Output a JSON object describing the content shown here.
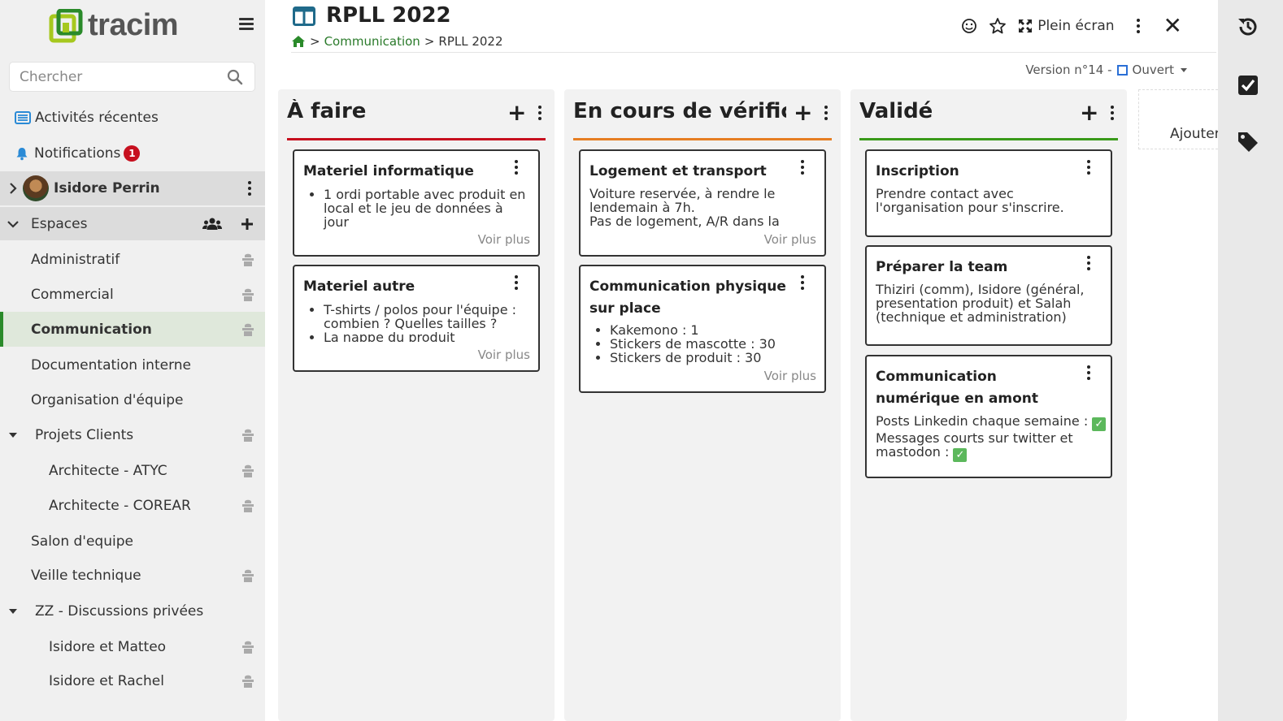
{
  "app": {
    "logo_text": "tracim"
  },
  "sidebar": {
    "search_placeholder": "Chercher",
    "recent_activities": "Activités récentes",
    "notifications": "Notifications",
    "notifications_count": "1",
    "user_name": "Isidore Perrin",
    "spaces_label": "Espaces",
    "spaces": [
      {
        "label": "Administratif"
      },
      {
        "label": "Commercial"
      },
      {
        "label": "Communication"
      },
      {
        "label": "Documentation interne"
      },
      {
        "label": "Organisation d'équipe"
      },
      {
        "label": "Projets Clients"
      },
      {
        "label": "Architecte - ATYC"
      },
      {
        "label": "Architecte - COREAR"
      },
      {
        "label": "Salon d'equipe"
      },
      {
        "label": "Veille technique"
      },
      {
        "label": "ZZ - Discussions privées"
      },
      {
        "label": "Isidore et Matteo"
      },
      {
        "label": "Isidore et Rachel"
      }
    ]
  },
  "header": {
    "title": "RPLL 2022",
    "breadcrumb_sep": ">",
    "breadcrumb_space": "Communication",
    "breadcrumb_current": "RPLL 2022",
    "fullscreen_label": "Plein écran",
    "version_label": "Version n°14 -",
    "status_label": "Ouvert"
  },
  "board": {
    "columns": [
      {
        "title": "À faire",
        "color": "#c7101f",
        "cards": [
          {
            "title": "Materiel informatique",
            "items": [
              "1 ordi portable avec produit en local et le jeu de données à jour"
            ],
            "more": "Voir plus"
          },
          {
            "title": "Materiel autre",
            "items": [
              "T-shirts / polos pour l'équipe : combien ? Quelles tailles ?",
              "La nappe du produit"
            ],
            "more": "Voir plus"
          }
        ]
      },
      {
        "title": "En cours de vérificati...",
        "color": "#e67e22",
        "cards": [
          {
            "title": "Logement et transport",
            "text": [
              "Voiture reservée, à rendre le lendemain à 7h.",
              "Pas de logement, A/R dans la"
            ],
            "more": "Voir plus"
          },
          {
            "title": "Communication physique sur place",
            "items": [
              "Kakemono : 1",
              "Stickers de mascotte : 30",
              "Stickers de produit : 30"
            ],
            "more": "Voir plus"
          }
        ]
      },
      {
        "title": "Validé",
        "color": "#3a9a1a",
        "cards": [
          {
            "title": "Inscription",
            "text": [
              "Prendre contact avec l'organisation pour s'inscrire."
            ]
          },
          {
            "title": "Préparer la team",
            "text": [
              "Thiziri (comm), Isidore (général, presentation produit) et Salah (technique et administration)"
            ]
          },
          {
            "title": "Communication numérique en amont",
            "text": [
              "Posts Linkedin chaque semaine :",
              "Messages courts sur twitter et mastodon :"
            ],
            "check_mark": "✓"
          }
        ]
      }
    ],
    "add_column_label": "Ajouter"
  }
}
